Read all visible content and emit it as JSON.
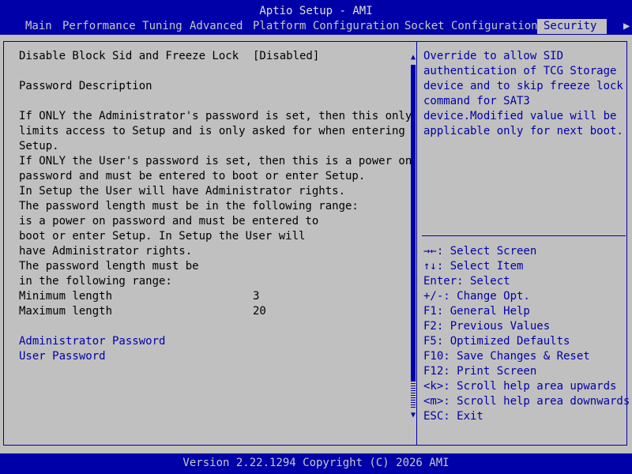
{
  "header": {
    "title": "Aptio Setup - AMI",
    "tabs": [
      {
        "label": "Main"
      },
      {
        "label": "Performance Tuning"
      },
      {
        "label": "Advanced"
      },
      {
        "label": "Platform Configuration"
      },
      {
        "label": "Socket Configuration"
      },
      {
        "label": "Security"
      }
    ],
    "active_tab": "Security",
    "more_tabs_glyph": "▶"
  },
  "main": {
    "setting": {
      "label": "Disable Block Sid and Freeze Lock",
      "value": "[Disabled]"
    },
    "section_title": "Password Description",
    "description_lines": [
      "If ONLY the Administrator's password is set, then this only",
      "limits access to Setup and is only asked for when entering",
      "Setup.",
      "If ONLY the User's password is set, then this is a power on",
      "password and must be entered to boot or enter Setup.",
      "In Setup the User will have Administrator rights.",
      "The password length must be in the following range:",
      "is a power on password and must be entered to",
      "boot or enter Setup. In Setup the User will",
      "have Administrator rights.",
      "The password length must be",
      "in the following range:"
    ],
    "min_length": {
      "label": "Minimum length",
      "value": "3"
    },
    "max_length": {
      "label": "Maximum length",
      "value": "20"
    },
    "admin_password_label": "Administrator Password",
    "user_password_label": "User Password"
  },
  "help": {
    "text_lines": [
      "Override to allow SID",
      "authentication of TCG Storage",
      "device and to skip freeze lock",
      "command for SAT3",
      "device.Modified value will be",
      "applicable only for next boot."
    ],
    "key_lines": [
      "→←: Select Screen",
      "↑↓: Select Item",
      "Enter: Select",
      "+/-: Change Opt.",
      "F1: General Help",
      "F2: Previous Values",
      "F5: Optimized Defaults",
      "F10: Save Changes & Reset",
      "F12: Print Screen",
      "<k>: Scroll help area upwards",
      "<m>: Scroll help area downwards",
      "ESC: Exit"
    ]
  },
  "scrollbar": {
    "up_glyph": "▲",
    "down_glyph": "▼",
    "thumb_fraction": 0.92
  },
  "footer": {
    "version": "Version 2.22.1294 Copyright (C) 2026 AMI"
  },
  "colors": {
    "accent": "#0000a8",
    "background": "#c0c0c0",
    "text": "#000000"
  }
}
